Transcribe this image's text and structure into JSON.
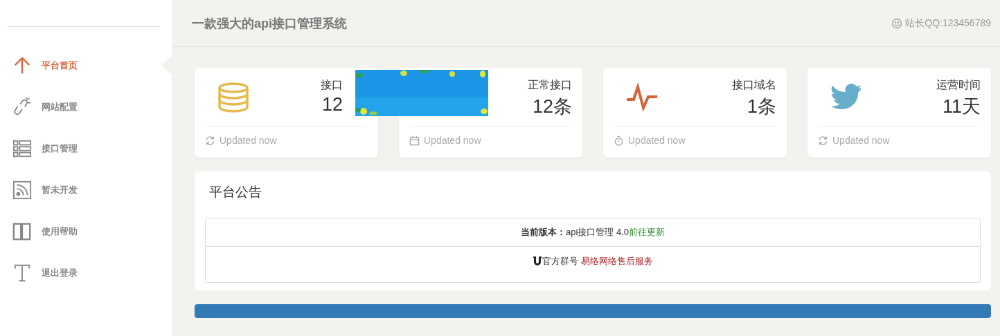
{
  "sidebar": {
    "items": [
      {
        "label": "平台首页",
        "kind": "arrow",
        "selected": true
      },
      {
        "label": "网站配置",
        "kind": "link",
        "selected": false
      },
      {
        "label": "接口管理",
        "kind": "list",
        "selected": false
      },
      {
        "label": "暂未开发",
        "kind": "rss",
        "selected": false
      },
      {
        "label": "使用帮助",
        "kind": "columns",
        "selected": false
      },
      {
        "label": "退出登录",
        "kind": "text",
        "selected": false
      }
    ]
  },
  "header": {
    "title": "一款强大的api接口管理系统",
    "contact": "站长QQ:123456789"
  },
  "stats": [
    {
      "label": "接口",
      "value": "12",
      "footer": "Updated now"
    },
    {
      "label": "正常接口",
      "value": "12条",
      "footer": "Updated now"
    },
    {
      "label": "接口域名",
      "value": "1条",
      "footer": "Updated now"
    },
    {
      "label": "运营时间",
      "value": "11天",
      "footer": "Updated now"
    }
  ],
  "progress": {
    "level": 1
  },
  "notice": {
    "title": "平台公告",
    "rows": [
      {
        "kind": "version",
        "text": "**当前版本：**api接口管理 4.0",
        "link": "前往更新"
      },
      {
        "kind": "group",
        "text": "官方群号",
        "link": "易络网络售后服务"
      }
    ]
  }
}
